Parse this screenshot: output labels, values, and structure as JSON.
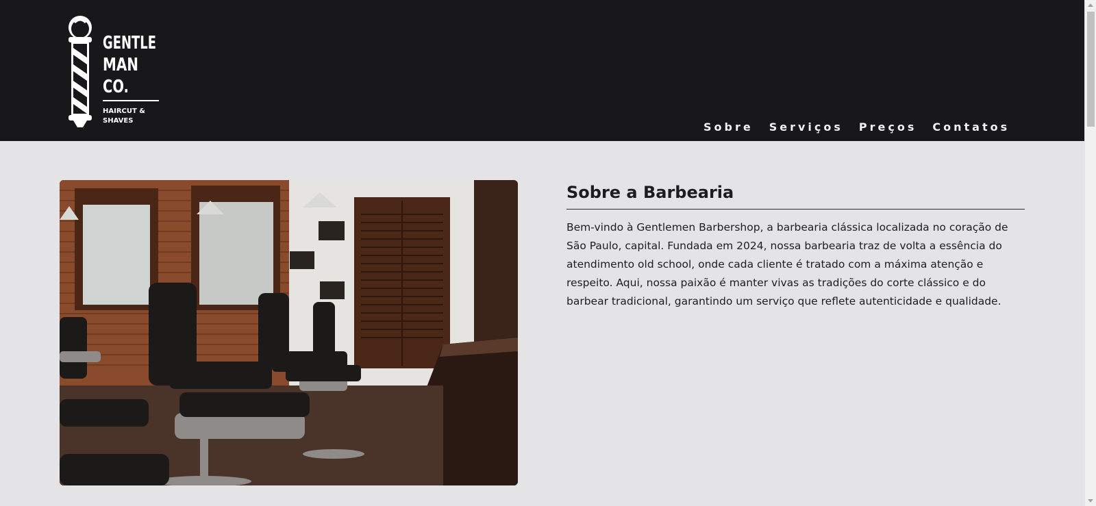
{
  "header": {
    "logo": {
      "line1": "GENTLE",
      "line2": "MAN",
      "line3": "CO.",
      "tagline1": "HAIRCUT &",
      "tagline2": "SHAVES",
      "icon": "barber-pole-icon"
    },
    "nav": [
      "Sobre",
      "Serviços",
      "Preços",
      "Contatos"
    ]
  },
  "about": {
    "title": "Sobre a Barbearia",
    "text": "Bem-vindo à Gentlemen Barbershop, a barbearia clássica localizada no coração de São Paulo, capital. Fundada em 2024, nossa barbearia traz de volta a essência do atendimento old school, onde cada cliente é tratado com a máxima atenção e respeito. Aqui, nossa paixão é manter vivas as tradições do corte clássico e do barbear tradicional, garantindo um serviço que reflete autenticidade e qualidade.",
    "image": "barbershop-interior-photo"
  },
  "colors": {
    "header_bg": "#18181b",
    "page_bg": "#e4e4e6",
    "text": "#1d1d1f",
    "nav_text": "#f2f2f2"
  }
}
